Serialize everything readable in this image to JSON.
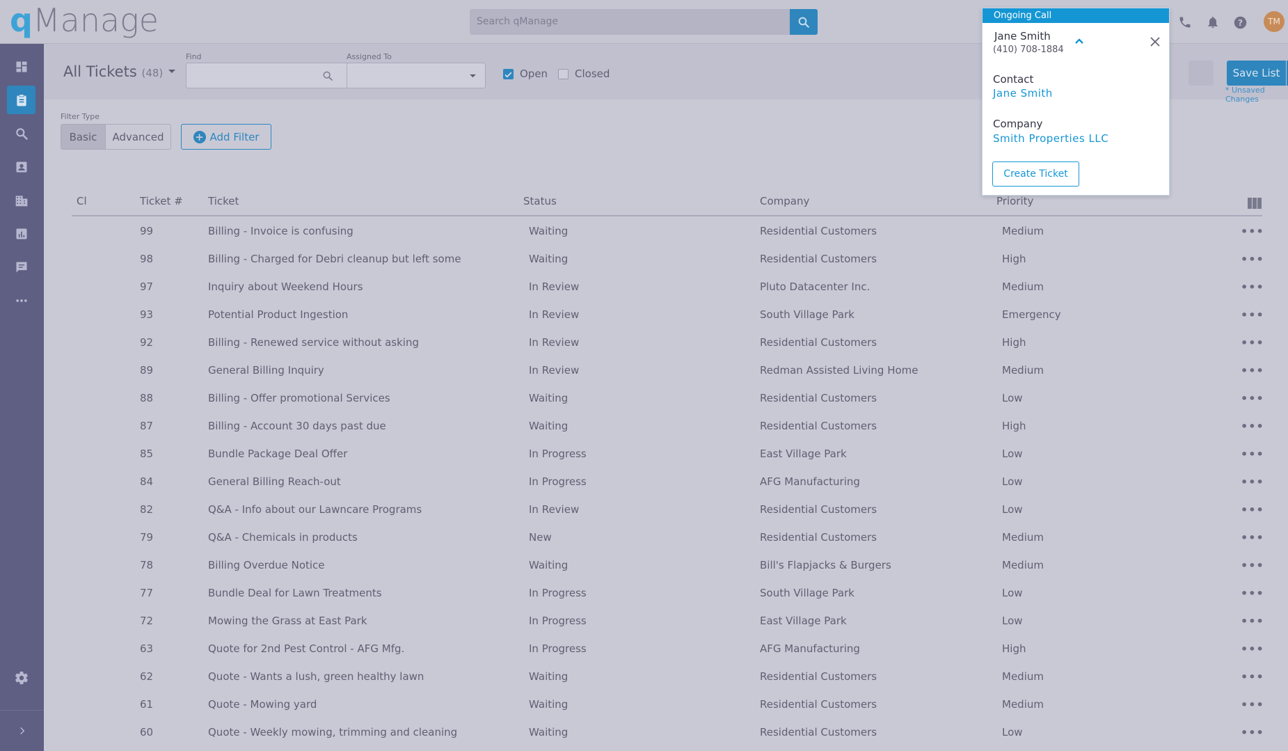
{
  "app": {
    "logo_q": "q",
    "logo_rest": "Manage",
    "search_placeholder": "Search qManage",
    "avatar_initials": "TM"
  },
  "filters": {
    "list_title": "All Tickets",
    "list_count": "(48)",
    "find_label": "Find",
    "find_value": "",
    "assigned_label": "Assigned To",
    "assigned_value": "",
    "open_label": "Open",
    "open_checked": true,
    "closed_label": "Closed",
    "closed_checked": false,
    "save_list_label": "Save List",
    "unsaved_text": "* Unsaved Changes",
    "filter_type_label": "Filter Type",
    "basic_label": "Basic",
    "advanced_label": "Advanced",
    "add_filter_label": "Add Filter"
  },
  "table": {
    "columns": [
      "Cl",
      "Ticket #",
      "Ticket",
      "Status",
      "Company",
      "Priority"
    ],
    "rows": [
      {
        "num": "99",
        "ticket": "Billing - Invoice is confusing",
        "status": "Waiting",
        "company": "Residential Customers",
        "priority": "Medium"
      },
      {
        "num": "98",
        "ticket": "Billing - Charged for Debri cleanup but left some",
        "status": "Waiting",
        "company": "Residential Customers",
        "priority": "High"
      },
      {
        "num": "97",
        "ticket": "Inquiry about Weekend Hours",
        "status": "In Review",
        "company": "Pluto Datacenter Inc.",
        "priority": "Medium"
      },
      {
        "num": "93",
        "ticket": "Potential Product Ingestion",
        "status": "In Review",
        "company": "South Village Park",
        "priority": "Emergency"
      },
      {
        "num": "92",
        "ticket": "Billing - Renewed service without asking",
        "status": "In Review",
        "company": "Residential Customers",
        "priority": "High"
      },
      {
        "num": "89",
        "ticket": "General Billing Inquiry",
        "status": "In Review",
        "company": "Redman Assisted Living Home",
        "priority": "Medium"
      },
      {
        "num": "88",
        "ticket": "Billing - Offer promotional Services",
        "status": "Waiting",
        "company": "Residential Customers",
        "priority": "Low"
      },
      {
        "num": "87",
        "ticket": "Billing - Account 30 days past due",
        "status": "Waiting",
        "company": "Residential Customers",
        "priority": "High"
      },
      {
        "num": "85",
        "ticket": "Bundle Package Deal Offer",
        "status": "In Progress",
        "company": "East Village Park",
        "priority": "Low"
      },
      {
        "num": "84",
        "ticket": "General Billing Reach-out",
        "status": "In Progress",
        "company": "AFG Manufacturing",
        "priority": "Low"
      },
      {
        "num": "82",
        "ticket": "Q&A - Info about our Lawncare Programs",
        "status": "In Review",
        "company": "Residential Customers",
        "priority": "Low"
      },
      {
        "num": "79",
        "ticket": "Q&A - Chemicals in products",
        "status": "New",
        "company": "Residential Customers",
        "priority": "Medium"
      },
      {
        "num": "78",
        "ticket": "Billing Overdue Notice",
        "status": "Waiting",
        "company": "Bill's Flapjacks & Burgers",
        "priority": "Medium"
      },
      {
        "num": "77",
        "ticket": "Bundle Deal for Lawn Treatments",
        "status": "In Progress",
        "company": "South Village Park",
        "priority": "Low"
      },
      {
        "num": "72",
        "ticket": "Mowing the Grass at East Park",
        "status": "In Progress",
        "company": "East Village Park",
        "priority": "Low"
      },
      {
        "num": "63",
        "ticket": "Quote for 2nd Pest Control - AFG Mfg.",
        "status": "In Progress",
        "company": "AFG Manufacturing",
        "priority": "High"
      },
      {
        "num": "62",
        "ticket": "Quote - Wants a lush, green healthy lawn",
        "status": "Waiting",
        "company": "Residential Customers",
        "priority": "Medium"
      },
      {
        "num": "61",
        "ticket": "Quote - Mowing yard",
        "status": "Waiting",
        "company": "Residential Customers",
        "priority": "Medium"
      },
      {
        "num": "60",
        "ticket": "Quote - Weekly mowing, trimming and cleaning",
        "status": "Waiting",
        "company": "Residential Customers",
        "priority": "Low"
      }
    ]
  },
  "call": {
    "header": "Ongoing Call",
    "caller_name": "Jane Smith",
    "caller_phone": "(410) 708-1884",
    "contact_label": "Contact",
    "contact_value": "Jane Smith",
    "company_label": "Company",
    "company_value": "Smith Properties LLC",
    "create_ticket_label": "Create Ticket"
  },
  "colors": {
    "accent": "#2f86bd",
    "call_accent": "#1596d4",
    "sidebar": "#5e5f83"
  }
}
